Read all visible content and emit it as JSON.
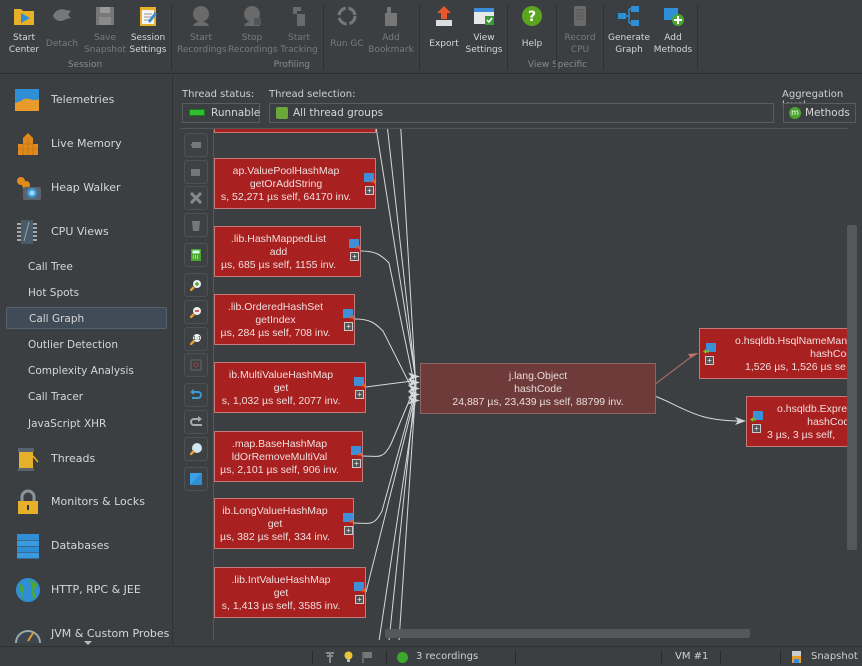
{
  "toolbar": {
    "groups": [
      {
        "label": "Session"
      },
      {
        "label": "Profiling"
      },
      {
        "label": "View Specific"
      }
    ],
    "buttons": [
      {
        "label1": "Start",
        "label2": "Center",
        "icon": "start-center-icon",
        "enabled": true
      },
      {
        "label1": "",
        "label2": "Detach",
        "icon": "detach-icon",
        "enabled": false
      },
      {
        "label1": "Save",
        "label2": "Snapshot",
        "icon": "save-snapshot-icon",
        "enabled": false
      },
      {
        "label1": "Session",
        "label2": "Settings",
        "icon": "session-settings-icon",
        "enabled": true
      },
      {
        "label1": "Start",
        "label2": "Recordings",
        "icon": "start-recordings-icon",
        "enabled": false
      },
      {
        "label1": "Stop",
        "label2": "Recordings",
        "icon": "stop-recordings-icon",
        "enabled": false
      },
      {
        "label1": "Start",
        "label2": "Tracking",
        "icon": "start-tracking-icon",
        "enabled": false
      },
      {
        "label1": "",
        "label2": "Run GC",
        "icon": "run-gc-icon",
        "enabled": false
      },
      {
        "label1": "Add",
        "label2": "Bookmark",
        "icon": "add-bookmark-icon",
        "enabled": false
      },
      {
        "label1": "",
        "label2": "Export",
        "icon": "export-icon",
        "enabled": true
      },
      {
        "label1": "View",
        "label2": "Settings",
        "icon": "view-settings-icon",
        "enabled": true
      },
      {
        "label1": "",
        "label2": "Help",
        "icon": "help-icon",
        "enabled": true
      },
      {
        "label1": "Record",
        "label2": "CPU",
        "icon": "record-cpu-icon",
        "enabled": false
      },
      {
        "label1": "Generate",
        "label2": "Graph",
        "icon": "generate-graph-icon",
        "enabled": true
      },
      {
        "label1": "Add",
        "label2": "Methods",
        "icon": "add-methods-icon",
        "enabled": true
      }
    ]
  },
  "sidebar": {
    "sections": [
      {
        "label": "Telemetries",
        "icon": "telemetries-icon"
      },
      {
        "label": "Live Memory",
        "icon": "live-memory-icon"
      },
      {
        "label": "Heap Walker",
        "icon": "heap-walker-icon"
      },
      {
        "label": "CPU Views",
        "icon": "cpu-views-icon"
      },
      {
        "label": "Threads",
        "icon": "threads-icon"
      },
      {
        "label": "Monitors & Locks",
        "icon": "monitors-locks-icon"
      },
      {
        "label": "Databases",
        "icon": "databases-icon"
      },
      {
        "label": "HTTP, RPC & JEE",
        "icon": "http-rpc-jee-icon"
      },
      {
        "label": "JVM & Custom Probes",
        "icon": "jvm-probes-icon"
      }
    ],
    "cpu_subitems": [
      {
        "label": "Call Tree",
        "active": false
      },
      {
        "label": "Hot Spots",
        "active": false
      },
      {
        "label": "Call Graph",
        "active": true
      },
      {
        "label": "Outlier Detection",
        "active": false
      },
      {
        "label": "Complexity Analysis",
        "active": false
      },
      {
        "label": "Call Tracer",
        "active": false
      },
      {
        "label": "JavaScript XHR",
        "active": false
      }
    ]
  },
  "filters": {
    "thread_status_label": "Thread status:",
    "thread_status_value": "Runnable",
    "thread_selection_label": "Thread selection:",
    "thread_selection_value": "All thread groups",
    "aggregation_label": "Aggregation level:",
    "aggregation_value": "Methods"
  },
  "graph_tools": [
    {
      "icon": "collapse-node-icon"
    },
    {
      "icon": "expand-node-icon"
    },
    {
      "icon": "remove-node-icon"
    },
    {
      "icon": "delete-icon"
    },
    {
      "icon": "calculator-icon"
    },
    {
      "icon": "zoom-in-icon"
    },
    {
      "icon": "zoom-out-icon"
    },
    {
      "icon": "zoom-reset-icon"
    },
    {
      "icon": "fit-selection-icon"
    },
    {
      "icon": "undo-icon"
    },
    {
      "icon": "redo-icon"
    },
    {
      "icon": "search-icon"
    },
    {
      "icon": "graph-overview-icon"
    }
  ],
  "graph": {
    "nodes": [
      {
        "id": "top-partial",
        "class_name": "",
        "method": "",
        "stats": "",
        "role": "caller"
      },
      {
        "id": "n1",
        "class_name": "ap.ValuePoolHashMap",
        "method": "getOrAddString",
        "stats": "s, 52,271 µs self, 64170 inv.",
        "role": "caller"
      },
      {
        "id": "n2",
        "class_name": ".lib.HashMappedList",
        "method": "add",
        "stats": "µs, 685 µs self, 1155 inv.",
        "role": "caller"
      },
      {
        "id": "n3",
        "class_name": ".lib.OrderedHashSet",
        "method": "getIndex",
        "stats": "µs, 284 µs self, 708 inv.",
        "role": "caller"
      },
      {
        "id": "n4",
        "class_name": "ib.MultiValueHashMap",
        "method": "get",
        "stats": "s, 1,032 µs self, 2077 inv.",
        "role": "caller"
      },
      {
        "id": "n5",
        "class_name": ".map.BaseHashMap",
        "method": "ldOrRemoveMultiVal",
        "stats": "µs, 2,101 µs self, 906 inv.",
        "role": "caller"
      },
      {
        "id": "n6",
        "class_name": "ib.LongValueHashMap",
        "method": "get",
        "stats": "µs, 382 µs self, 334 inv.",
        "role": "caller"
      },
      {
        "id": "n7",
        "class_name": ".lib.IntValueHashMap",
        "method": "get",
        "stats": "s, 1,413 µs self, 3585 inv.",
        "role": "caller"
      },
      {
        "id": "center",
        "class_name": "j.lang.Object",
        "method": "hashCode",
        "stats": "24,887 µs, 23,439 µs self, 88799 inv.",
        "role": "selected"
      },
      {
        "id": "c1",
        "class_name": "o.hsqldb.HsqlNameManag",
        "method": "hashCode",
        "stats": "1,526 µs, 1,526 µs se",
        "role": "callee"
      },
      {
        "id": "c2",
        "class_name": "o.hsqldb.Expre",
        "method": "hashCode",
        "stats": "3 µs, 3 µs self,",
        "role": "callee"
      }
    ],
    "colors": {
      "node_fill": "#a8201f",
      "selected_fill": "#6e3b3a",
      "edge": "#d8d8d8",
      "edge_highlight": "#c07070"
    }
  },
  "statusbar": {
    "recordings": "3 recordings",
    "vm": "VM #1",
    "mode": "Snapshot"
  }
}
